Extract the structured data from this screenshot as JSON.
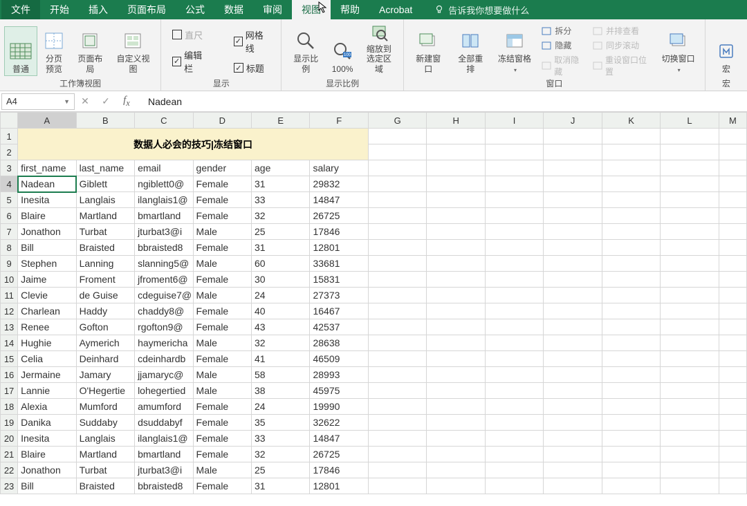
{
  "menu": {
    "tabs": [
      "文件",
      "开始",
      "插入",
      "页面布局",
      "公式",
      "数据",
      "审阅",
      "视图",
      "帮助",
      "Acrobat"
    ],
    "active_index": 7,
    "tell_me": "告诉我你想要做什么"
  },
  "ribbon": {
    "groups": {
      "workbook_views": {
        "label": "工作簿视图",
        "items": [
          "普通",
          "分页\n预览",
          "页面布局",
          "自定义视图"
        ],
        "active_index": 0
      },
      "show": {
        "label": "显示",
        "checks": [
          {
            "label": "直尺",
            "checked": false
          },
          {
            "label": "编辑栏",
            "checked": true
          },
          {
            "label": "网格线",
            "checked": true
          },
          {
            "label": "标题",
            "checked": true
          }
        ]
      },
      "zoom": {
        "label": "显示比例",
        "items": [
          "显示比例",
          "100%",
          "缩放到\n选定区域"
        ]
      },
      "window": {
        "label": "窗口",
        "items": [
          "新建窗口",
          "全部重排",
          "冻结窗格"
        ],
        "tiny": [
          "拆分",
          "隐藏",
          "取消隐藏"
        ],
        "tiny2": [
          "并排查看",
          "同步滚动",
          "重设窗口位置"
        ],
        "switch": "切换窗口"
      },
      "macros": {
        "label": "宏",
        "item": "宏"
      }
    }
  },
  "formula_bar": {
    "name": "A4",
    "value": "Nadean"
  },
  "columns": [
    "A",
    "B",
    "C",
    "D",
    "E",
    "F",
    "G",
    "H",
    "I",
    "J",
    "K",
    "L",
    "M"
  ],
  "active_col": "A",
  "active_row": 4,
  "banner": "数据人必会的技巧|冻结窗口",
  "headers": [
    "first_name",
    "last_name",
    "email",
    "gender",
    "age",
    "salary"
  ],
  "rows": [
    {
      "n": 4,
      "first": "Nadean",
      "last": "Giblett",
      "email": "ngiblett0@",
      "gender": "Female",
      "age": 31,
      "salary": 29832
    },
    {
      "n": 5,
      "first": "Inesita",
      "last": "Langlais",
      "email": "ilanglais1@",
      "gender": "Female",
      "age": 33,
      "salary": 14847
    },
    {
      "n": 6,
      "first": "Blaire",
      "last": "Martland",
      "email": "bmartland",
      "gender": "Female",
      "age": 32,
      "salary": 26725
    },
    {
      "n": 7,
      "first": "Jonathon",
      "last": "Turbat",
      "email": "jturbat3@i",
      "gender": "Male",
      "age": 25,
      "salary": 17846
    },
    {
      "n": 8,
      "first": "Bill",
      "last": "Braisted",
      "email": "bbraisted8",
      "gender": "Female",
      "age": 31,
      "salary": 12801
    },
    {
      "n": 9,
      "first": "Stephen",
      "last": "Lanning",
      "email": "slanning5@",
      "gender": "Male",
      "age": 60,
      "salary": 33681
    },
    {
      "n": 10,
      "first": "Jaime",
      "last": "Froment",
      "email": "jfroment6@",
      "gender": "Female",
      "age": 30,
      "salary": 15831
    },
    {
      "n": 11,
      "first": "Clevie",
      "last": "de Guise",
      "email": "cdeguise7@",
      "gender": "Male",
      "age": 24,
      "salary": 27373
    },
    {
      "n": 12,
      "first": "Charlean",
      "last": "Haddy",
      "email": "chaddy8@",
      "gender": "Female",
      "age": 40,
      "salary": 16467
    },
    {
      "n": 13,
      "first": "Renee",
      "last": "Gofton",
      "email": "rgofton9@",
      "gender": "Female",
      "age": 43,
      "salary": 42537
    },
    {
      "n": 14,
      "first": "Hughie",
      "last": "Aymerich",
      "email": "haymericha",
      "gender": "Male",
      "age": 32,
      "salary": 28638
    },
    {
      "n": 15,
      "first": "Celia",
      "last": "Deinhard",
      "email": "cdeinhardb",
      "gender": "Female",
      "age": 41,
      "salary": 46509
    },
    {
      "n": 16,
      "first": "Jermaine",
      "last": "Jamary",
      "email": "jjamaryc@",
      "gender": "Male",
      "age": 58,
      "salary": 28993
    },
    {
      "n": 17,
      "first": "Lannie",
      "last": "O'Hegertie",
      "email": "lohegertied",
      "gender": "Male",
      "age": 38,
      "salary": 45975
    },
    {
      "n": 18,
      "first": "Alexia",
      "last": "Mumford",
      "email": "amumford",
      "gender": "Female",
      "age": 24,
      "salary": 19990
    },
    {
      "n": 19,
      "first": "Danika",
      "last": "Suddaby",
      "email": "dsuddabyf",
      "gender": "Female",
      "age": 35,
      "salary": 32622
    },
    {
      "n": 20,
      "first": "Inesita",
      "last": "Langlais",
      "email": "ilanglais1@",
      "gender": "Female",
      "age": 33,
      "salary": 14847
    },
    {
      "n": 21,
      "first": "Blaire",
      "last": "Martland",
      "email": "bmartland",
      "gender": "Female",
      "age": 32,
      "salary": 26725
    },
    {
      "n": 22,
      "first": "Jonathon",
      "last": "Turbat",
      "email": "jturbat3@i",
      "gender": "Male",
      "age": 25,
      "salary": 17846
    },
    {
      "n": 23,
      "first": "Bill",
      "last": "Braisted",
      "email": "bbraisted8",
      "gender": "Female",
      "age": 31,
      "salary": 12801
    }
  ]
}
